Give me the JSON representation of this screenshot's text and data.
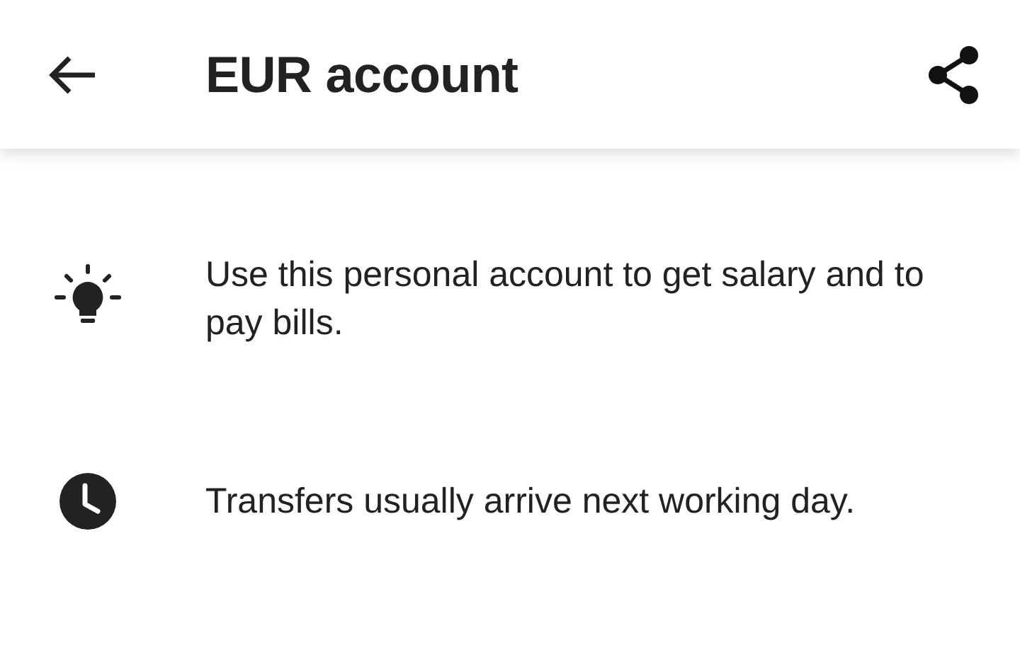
{
  "app_bar": {
    "title": "EUR account"
  },
  "info_items": [
    {
      "kind": "tip",
      "text": "Use this personal account to get salary and to pay bills."
    },
    {
      "kind": "time",
      "text": "Transfers usually arrive next working day."
    }
  ]
}
